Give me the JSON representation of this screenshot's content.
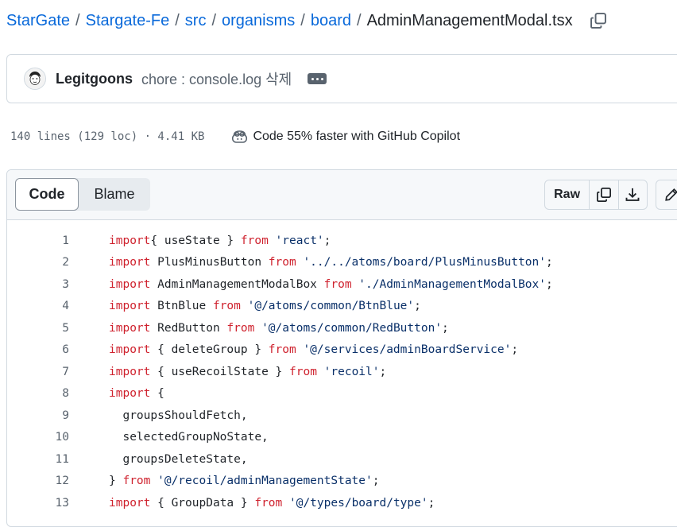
{
  "breadcrumb": {
    "items": [
      "StarGate",
      "Stargate-Fe",
      "src",
      "organisms",
      "board"
    ],
    "separator": "/",
    "file": "AdminManagementModal.tsx"
  },
  "commit": {
    "author": "Legitgoons",
    "message": "chore : console.log 삭제"
  },
  "file_info": {
    "lines": "140 lines (129 loc) · 4.41 KB",
    "copilot": "Code 55% faster with GitHub Copilot"
  },
  "tabs": {
    "code": "Code",
    "blame": "Blame"
  },
  "toolbar": {
    "raw": "Raw",
    "icons": [
      "copy-icon",
      "download-icon",
      "pencil-icon"
    ]
  },
  "colors": {
    "link": "#0969da",
    "keyword": "#cf222e",
    "string": "#0a3069",
    "muted": "#59636e"
  },
  "code_lines": [
    {
      "n": "1",
      "tokens": [
        [
          "kw",
          "import"
        ],
        [
          "",
          "{ useState } "
        ],
        [
          "kw",
          "from"
        ],
        [
          "",
          ""
        ],
        [
          "str",
          " 'react'"
        ],
        [
          "",
          ";"
        ]
      ]
    },
    {
      "n": "2",
      "tokens": [
        [
          "kw",
          "import"
        ],
        [
          "",
          " PlusMinusButton "
        ],
        [
          "kw",
          "from"
        ],
        [
          "str",
          " '../../atoms/board/PlusMinusButton'"
        ],
        [
          "",
          ";"
        ]
      ]
    },
    {
      "n": "3",
      "tokens": [
        [
          "kw",
          "import"
        ],
        [
          "",
          " AdminManagementModalBox "
        ],
        [
          "kw",
          "from"
        ],
        [
          "str",
          " './AdminManagementModalBox'"
        ],
        [
          "",
          ";"
        ]
      ]
    },
    {
      "n": "4",
      "tokens": [
        [
          "kw",
          "import"
        ],
        [
          "",
          " BtnBlue "
        ],
        [
          "kw",
          "from"
        ],
        [
          "str",
          " '@/atoms/common/BtnBlue'"
        ],
        [
          "",
          ";"
        ]
      ]
    },
    {
      "n": "5",
      "tokens": [
        [
          "kw",
          "import"
        ],
        [
          "",
          " RedButton "
        ],
        [
          "kw",
          "from"
        ],
        [
          "str",
          " '@/atoms/common/RedButton'"
        ],
        [
          "",
          ";"
        ]
      ]
    },
    {
      "n": "6",
      "tokens": [
        [
          "kw",
          "import"
        ],
        [
          "",
          " { deleteGroup } "
        ],
        [
          "kw",
          "from"
        ],
        [
          "str",
          " '@/services/adminBoardService'"
        ],
        [
          "",
          ";"
        ]
      ]
    },
    {
      "n": "7",
      "tokens": [
        [
          "kw",
          "import"
        ],
        [
          "",
          " { useRecoilState } "
        ],
        [
          "kw",
          "from"
        ],
        [
          "str",
          " 'recoil'"
        ],
        [
          "",
          ";"
        ]
      ]
    },
    {
      "n": "8",
      "tokens": [
        [
          "kw",
          "import"
        ],
        [
          "",
          " {"
        ]
      ]
    },
    {
      "n": "9",
      "tokens": [
        [
          "",
          "  groupsShouldFetch,"
        ]
      ]
    },
    {
      "n": "10",
      "tokens": [
        [
          "",
          "  selectedGroupNoState,"
        ]
      ]
    },
    {
      "n": "11",
      "tokens": [
        [
          "",
          "  groupsDeleteState,"
        ]
      ]
    },
    {
      "n": "12",
      "tokens": [
        [
          "",
          "} "
        ],
        [
          "kw",
          "from"
        ],
        [
          "str",
          " '@/recoil/adminManagementState'"
        ],
        [
          "",
          ";"
        ]
      ]
    },
    {
      "n": "13",
      "tokens": [
        [
          "kw",
          "import"
        ],
        [
          "",
          " { GroupData } "
        ],
        [
          "kw",
          "from"
        ],
        [
          "str",
          " '@/types/board/type'"
        ],
        [
          "",
          ";"
        ]
      ]
    }
  ]
}
